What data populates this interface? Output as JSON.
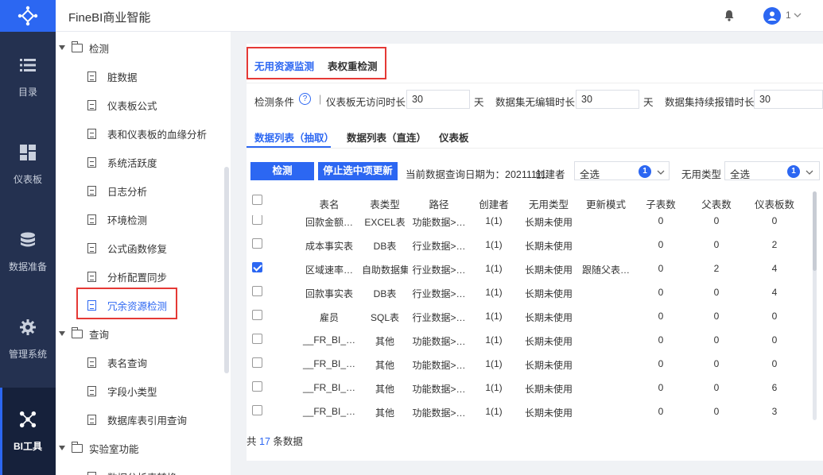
{
  "app": {
    "title": "FineBI商业智能",
    "user": "1"
  },
  "nav": {
    "items": [
      {
        "key": "catalog",
        "label": "目录",
        "icon": "list-icon"
      },
      {
        "key": "dashboard",
        "label": "仪表板",
        "icon": "dashboard-icon"
      },
      {
        "key": "dataprep",
        "label": "数据准备",
        "icon": "database-icon"
      },
      {
        "key": "admin",
        "label": "管理系统",
        "icon": "gear-icon"
      },
      {
        "key": "bitools",
        "label": "BI工具",
        "icon": "network-icon"
      }
    ]
  },
  "tree": {
    "group1": "检测",
    "group1_items": [
      "脏数据",
      "仪表板公式",
      "表和仪表板的血缘分析",
      "系统活跃度",
      "日志分析",
      "环境检测",
      "公式函数修复",
      "分析配置同步",
      "冗余资源检测"
    ],
    "group2": "查询",
    "group2_items": [
      "表名查询",
      "字段小类型",
      "数据库表引用查询"
    ],
    "group3": "实验室功能",
    "group3_items": [
      "数据分析表转换"
    ]
  },
  "main": {
    "tab_unused": "无用资源监测",
    "tab_weight": "表权重检测",
    "cond_label": "检测条件",
    "cond_sep": "|",
    "cond1_label": "仪表板无访问时长",
    "cond1_value": "30",
    "cond1_unit": "天",
    "cond2_label": "数据集无编辑时长",
    "cond2_value": "30",
    "cond2_unit": "天",
    "cond3_label": "数据集持续报错时长",
    "cond3_value": "30",
    "subtab1": "数据列表（抽取）",
    "subtab2": "数据列表（直连）",
    "subtab3": "仪表板",
    "btn_detect": "检测",
    "btn_stop": "停止选中项更新",
    "query_date": "当前数据查询日期为：20211111",
    "creator_label": "创建者",
    "creator_value": "全选",
    "creator_count": "1",
    "type_label": "无用类型",
    "type_value": "全选",
    "type_count": "1",
    "columns": [
      "表名",
      "表类型",
      "路径",
      "创建者",
      "无用类型",
      "更新模式",
      "子表数",
      "父表数",
      "仪表板数"
    ],
    "rows": [
      {
        "checked": false,
        "name": "回款金额…",
        "type": "EXCEL表",
        "path": "功能数据>…",
        "creator": "1(1)",
        "unused": "长期未使用",
        "mode": "",
        "children": "0",
        "parents": "0",
        "dashboards": "0"
      },
      {
        "checked": false,
        "name": "成本事实表",
        "type": "DB表",
        "path": "行业数据>…",
        "creator": "1(1)",
        "unused": "长期未使用",
        "mode": "",
        "children": "0",
        "parents": "0",
        "dashboards": "2"
      },
      {
        "checked": true,
        "name": "区域速率…",
        "type": "自助数据集",
        "path": "行业数据>…",
        "creator": "1(1)",
        "unused": "长期未使用",
        "mode": "跟随父表…",
        "children": "0",
        "parents": "2",
        "dashboards": "4"
      },
      {
        "checked": false,
        "name": "回款事实表",
        "type": "DB表",
        "path": "行业数据>…",
        "creator": "1(1)",
        "unused": "长期未使用",
        "mode": "",
        "children": "0",
        "parents": "0",
        "dashboards": "4"
      },
      {
        "checked": false,
        "name": "雇员",
        "type": "SQL表",
        "path": "行业数据>…",
        "creator": "1(1)",
        "unused": "长期未使用",
        "mode": "",
        "children": "0",
        "parents": "0",
        "dashboards": "0"
      },
      {
        "checked": false,
        "name": "__FR_BI_…",
        "type": "其他",
        "path": "功能数据>…",
        "creator": "1(1)",
        "unused": "长期未使用",
        "mode": "",
        "children": "0",
        "parents": "0",
        "dashboards": "0"
      },
      {
        "checked": false,
        "name": "__FR_BI_…",
        "type": "其他",
        "path": "功能数据>…",
        "creator": "1(1)",
        "unused": "长期未使用",
        "mode": "",
        "children": "0",
        "parents": "0",
        "dashboards": "0"
      },
      {
        "checked": false,
        "name": "__FR_BI_…",
        "type": "其他",
        "path": "功能数据>…",
        "creator": "1(1)",
        "unused": "长期未使用",
        "mode": "",
        "children": "0",
        "parents": "0",
        "dashboards": "6"
      },
      {
        "checked": false,
        "name": "__FR_BI_…",
        "type": "其他",
        "path": "功能数据>…",
        "creator": "1(1)",
        "unused": "长期未使用",
        "mode": "",
        "children": "0",
        "parents": "0",
        "dashboards": "3"
      }
    ],
    "footer_prefix": "共",
    "footer_count": "17",
    "footer_suffix": "条数据"
  },
  "colors": {
    "accent": "#2c67f2",
    "nav_bg": "#243150",
    "highlight": "#e53935"
  }
}
